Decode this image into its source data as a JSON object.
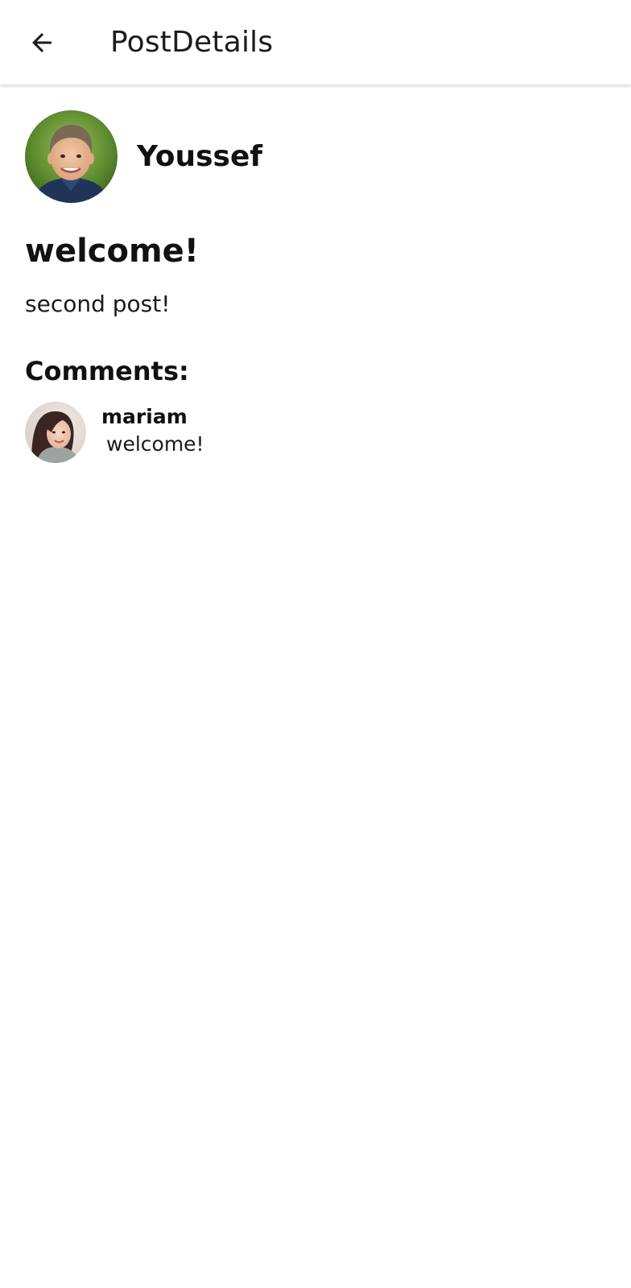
{
  "app_bar": {
    "back_icon": "arrow-left-icon",
    "title": "PostDetails"
  },
  "post": {
    "author": {
      "name": "Youssef",
      "avatar": "boy-avatar-photo"
    },
    "title": "welcome!",
    "body": "second post!"
  },
  "comments": {
    "heading": "Comments:",
    "items": [
      {
        "author": "mariam",
        "avatar": "girl-avatar-photo",
        "text": "welcome!"
      }
    ]
  }
}
